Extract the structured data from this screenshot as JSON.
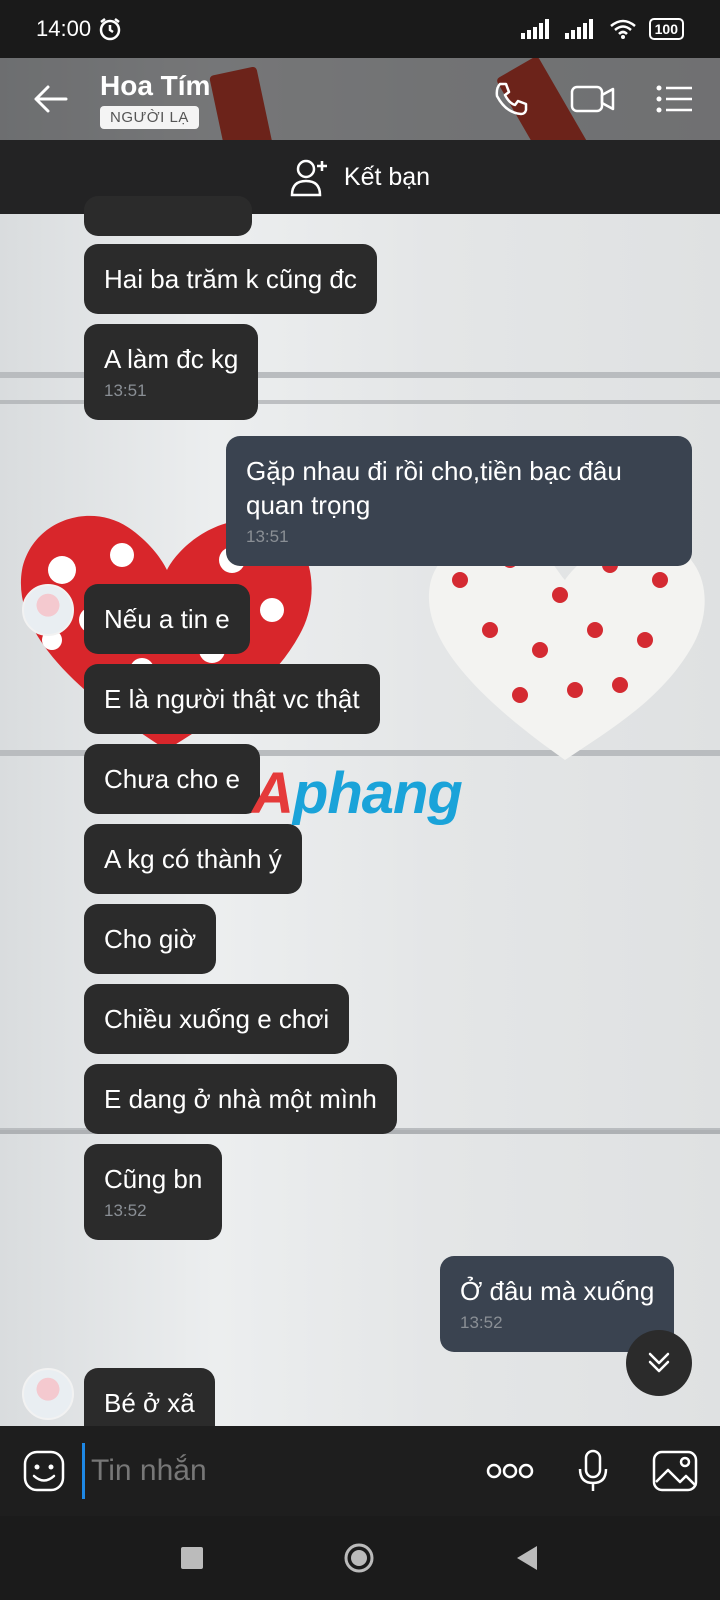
{
  "status_bar": {
    "time": "14:00",
    "battery": "100"
  },
  "header": {
    "title": "Hoa Tím",
    "badge": "NGƯỜI LẠ"
  },
  "add_friend": {
    "label": "Kết bạn"
  },
  "messages": [
    {
      "text": "Hai ba trăm k cũng đc"
    },
    {
      "text": "A làm đc kg",
      "time": "13:51"
    },
    {
      "text": "Gặp nhau đi rồi cho,tiền bạc đâu quan trọng",
      "time": "13:51"
    },
    {
      "text": "Nếu a tin e"
    },
    {
      "text": "E là người thật vc thật"
    },
    {
      "text": "Chưa cho e"
    },
    {
      "text": "A kg có thành ý"
    },
    {
      "text": "Cho giờ"
    },
    {
      "text": "Chiều xuống e chơi"
    },
    {
      "text": "E dang ở nhà một mình"
    },
    {
      "text": "Cũng bn",
      "time": "13:52"
    },
    {
      "text": "Ở đâu mà xuống",
      "time": "13:52"
    },
    {
      "text": "Bé ở xã"
    }
  ],
  "watermark": {
    "a": "A",
    "rest": "phang"
  },
  "input": {
    "placeholder": "Tin nhắn"
  },
  "colors": {
    "accent": "#1e88e5",
    "bubble_in": "#2b2b2b",
    "bubble_out": "#3a4350"
  }
}
